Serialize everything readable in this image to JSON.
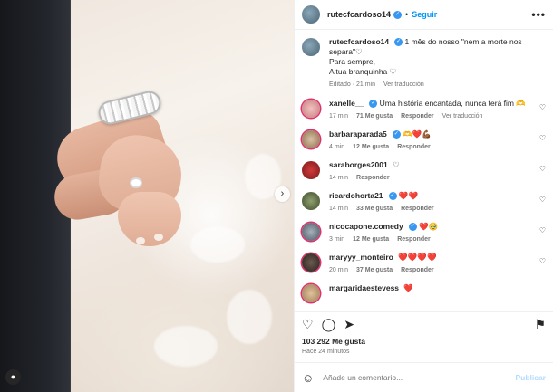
{
  "header": {
    "username": "rutecfcardoso14",
    "follow_label": "Seguir",
    "dot": "•",
    "more": "•••"
  },
  "caption": {
    "username": "rutecfcardoso14",
    "line1": "1 mês do nosso \"nem a morte nos separa\"♡",
    "line2": "Para sempre,",
    "line3": "A tua branquinha ♡",
    "meta_edited": "Editado · 21 min",
    "meta_translate": "Ver traducción"
  },
  "comments": [
    {
      "user": "xanelle__",
      "text": "Uma história encantada, nunca terá fim 🫶",
      "time": "17 min",
      "likes": "71 Me gusta",
      "reply": "Responder",
      "translate": "Ver traducción"
    },
    {
      "user": "barbaraparada5",
      "text": "🫶❤️💪🏾",
      "time": "4 min",
      "likes": "12 Me gusta",
      "reply": "Responder"
    },
    {
      "user": "saraborges2001",
      "text": "♡",
      "time": "14 min",
      "likes": "",
      "reply": "Responder"
    },
    {
      "user": "ricardohorta21",
      "text": "❤️❤️",
      "time": "14 min",
      "likes": "33 Me gusta",
      "reply": "Responder"
    },
    {
      "user": "nicocapone.comedy",
      "text": "❤️🥹",
      "time": "3 min",
      "likes": "12 Me gusta",
      "reply": "Responder"
    },
    {
      "user": "maryyy_monteiro",
      "text": "❤️❤️❤️❤️",
      "time": "20 min",
      "likes": "37 Me gusta",
      "reply": "Responder"
    },
    {
      "user": "margaridaestevess",
      "text": "❤️",
      "time": "",
      "likes": "",
      "reply": ""
    }
  ],
  "footer": {
    "likes": "103 292 Me gusta",
    "ago": "Hace 24 minutos",
    "add_placeholder": "Añade un comentario...",
    "publish": "Publicar"
  },
  "colors": {
    "accent": "#0095f6",
    "verified": "#3897f0",
    "heart": "#e0245e"
  }
}
